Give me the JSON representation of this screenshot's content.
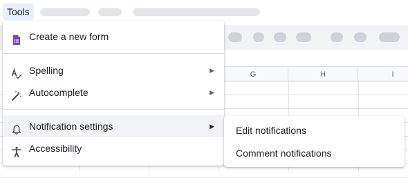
{
  "menubar": {
    "tools_label": "Tools"
  },
  "columns": [
    "G",
    "H",
    "I"
  ],
  "tools_menu": {
    "items": [
      {
        "label": "Create a new form",
        "icon": "forms-icon",
        "submenu": false
      },
      {
        "label": "Spelling",
        "icon": "spellcheck-icon",
        "submenu": true
      },
      {
        "label": "Autocomplete",
        "icon": "magic-wand-icon",
        "submenu": true
      },
      {
        "label": "Notification settings",
        "icon": "bell-icon",
        "submenu": true,
        "highlighted": true
      },
      {
        "label": "Accessibility",
        "icon": "accessibility-icon",
        "submenu": false
      }
    ],
    "submenu_arrow": "▶"
  },
  "notification_submenu": {
    "items": [
      {
        "label": "Edit notifications"
      },
      {
        "label": "Comment notifications"
      }
    ]
  },
  "colors": {
    "forms_purple": "#7248b9",
    "highlight_bg": "#f1f3f4",
    "menubar_active_bg": "#e8f0fe"
  }
}
